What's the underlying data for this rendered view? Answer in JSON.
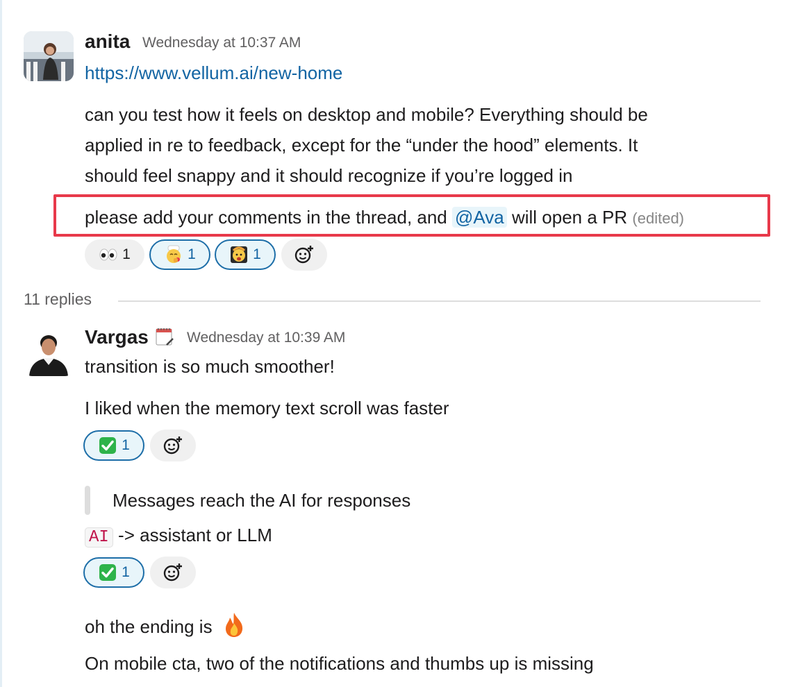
{
  "message": {
    "author": "anita",
    "timestamp": "Wednesday at 10:37 AM",
    "link": "https://www.vellum.ai/new-home",
    "para1": [
      "can you test how it feels on desktop and mobile? Everything should be",
      "applied in re to feedback, except for the “under the hood” elements. It",
      "should feel snappy and it should recognize if you’re logged in"
    ],
    "para2_before": "please add your comments in the thread, and",
    "mention": "@Ava",
    "para2_after": "will open a PR",
    "edited": "(edited)",
    "reactions": [
      {
        "emoji": "eyes",
        "count": "1"
      },
      {
        "emoji": "chef-kiss",
        "count": "1"
      },
      {
        "emoji": "mind-blown",
        "count": "1"
      }
    ]
  },
  "thread": {
    "replies_label": "11 replies"
  },
  "reply": {
    "author": "Vargas",
    "status_emoji": "calendar-notepad",
    "timestamp": "Wednesday at 10:39 AM",
    "msg1": "transition is so much smoother!",
    "msg2": "I liked when the memory text scroll was faster",
    "reaction1": {
      "emoji": "check-mark",
      "count": "1"
    },
    "quote": "Messages reach the AI for responses",
    "code": "AI",
    "msg3_after": "-> assistant or LLM",
    "reaction2": {
      "emoji": "check-mark",
      "count": "1"
    },
    "msg4": "oh the ending is",
    "msg4_emoji": "fire",
    "msg5": "On mobile cta, two of the notifications and thumbs up is missing"
  },
  "colors": {
    "link": "#1264a3",
    "highlight_border": "#e8394a",
    "reaction_active_border": "#1d6ea8",
    "check_green": "#2eb34a"
  }
}
